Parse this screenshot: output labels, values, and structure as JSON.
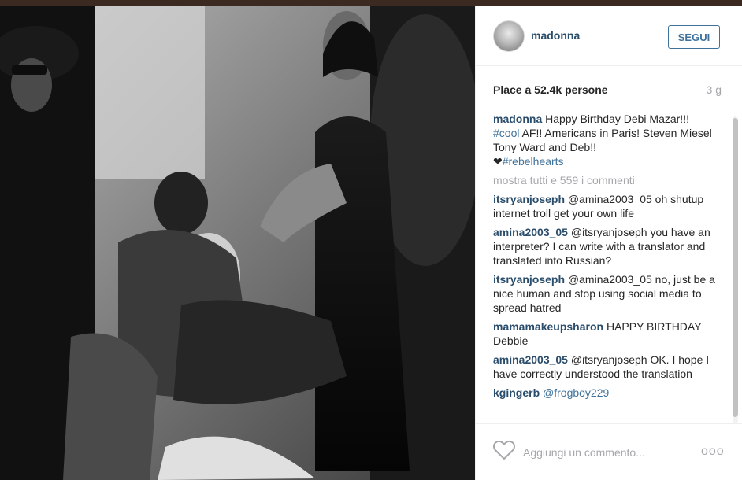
{
  "post": {
    "username": "madonna",
    "follow_label": "SEGUI",
    "likes": "Place a 52.4k persone",
    "time": "3 g",
    "caption": {
      "user": "madonna",
      "text_1": "Happy Birthday Debi Mazar!!!",
      "tag_1": "#cool",
      "text_2": "AF!! Americans in Paris! Steven Miesel Tony Ward and Deb!!",
      "heart": "❤",
      "tag_2": "#rebelhearts"
    },
    "view_all_comments": "mostra tutti e 559 i commenti",
    "comments": [
      {
        "user": "itsryanjoseph",
        "text": "@amina2003_05 oh shutup internet troll get your own life"
      },
      {
        "user": "amina2003_05",
        "text": "@itsryanjoseph you have an interpreter? I can write with a translator and translated into Russian?"
      },
      {
        "user": "itsryanjoseph",
        "text": "@amina2003_05 no, just be a nice human and stop using social media to spread hatred"
      },
      {
        "user": "mamamakeupsharon",
        "text": "HAPPY BIRTHDAY Debbie"
      },
      {
        "user": "amina2003_05",
        "text": "@itsryanjoseph OK. I hope I have correctly understood the translation"
      },
      {
        "user": "kgingerb",
        "text": "@frogboy229"
      }
    ],
    "add_comment_placeholder": "Aggiungi un commento...",
    "more_options": "ooo"
  },
  "icons": {
    "heart": "heart-icon",
    "more": "more-options-icon"
  },
  "colors": {
    "username": "#2a4d6b",
    "link": "#3f729b",
    "muted": "#a5a7aa"
  }
}
